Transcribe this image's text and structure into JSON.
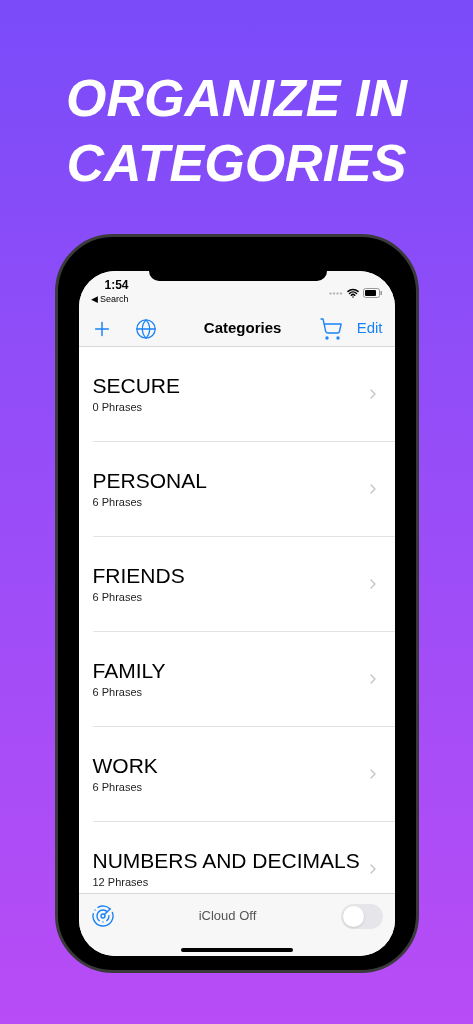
{
  "headline": "ORGANIZE IN CATEGORIES",
  "status_bar": {
    "time": "1:54",
    "back": "◀ Search"
  },
  "nav": {
    "title": "Categories",
    "edit": "Edit"
  },
  "categories": [
    {
      "name": "SECURE",
      "count": "0 Phrases"
    },
    {
      "name": "PERSONAL",
      "count": "6 Phrases"
    },
    {
      "name": "FRIENDS",
      "count": "6 Phrases"
    },
    {
      "name": "FAMILY",
      "count": "6 Phrases"
    },
    {
      "name": "WORK",
      "count": "6 Phrases"
    },
    {
      "name": "NUMBERS AND DECIMALS",
      "count": "12 Phrases"
    }
  ],
  "bottom_bar": {
    "label": "iCloud Off",
    "on": false
  }
}
